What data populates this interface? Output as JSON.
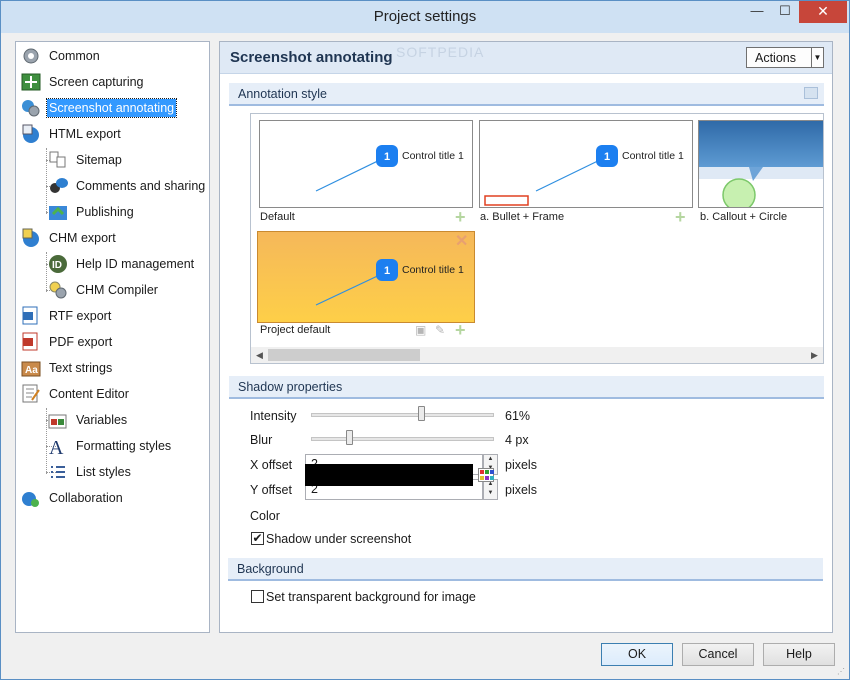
{
  "window": {
    "title": "Project settings",
    "minimize": "—",
    "maximize": "☐",
    "close": "✕"
  },
  "tree": {
    "items": [
      {
        "label": "Common",
        "icon": "gear-icon"
      },
      {
        "label": "Screen capturing",
        "icon": "capture-icon"
      },
      {
        "label": "Screenshot annotating",
        "icon": "annotate-icon",
        "selected": true
      },
      {
        "label": "HTML export",
        "icon": "html-export-icon"
      },
      {
        "label": "Sitemap",
        "icon": "sitemap-icon"
      },
      {
        "label": "Comments and sharing",
        "icon": "comments-icon"
      },
      {
        "label": "Publishing",
        "icon": "publishing-icon"
      },
      {
        "label": "CHM export",
        "icon": "chm-export-icon"
      },
      {
        "label": "Help ID management",
        "icon": "help-id-icon"
      },
      {
        "label": "CHM Compiler",
        "icon": "chm-compiler-icon"
      },
      {
        "label": "RTF export",
        "icon": "rtf-export-icon"
      },
      {
        "label": "PDF export",
        "icon": "pdf-export-icon"
      },
      {
        "label": "Text strings",
        "icon": "text-strings-icon"
      },
      {
        "label": "Content Editor",
        "icon": "content-editor-icon"
      },
      {
        "label": "Variables",
        "icon": "variables-icon"
      },
      {
        "label": "Formatting styles",
        "icon": "formatting-icon"
      },
      {
        "label": "List styles",
        "icon": "list-styles-icon"
      },
      {
        "label": "Collaboration",
        "icon": "collaboration-icon"
      }
    ]
  },
  "panel": {
    "title": "Screenshot annotating",
    "watermark": "SOFTPEDIA",
    "actions_label": "Actions"
  },
  "annotation_style": {
    "section_label": "Annotation style",
    "callout_number": "1",
    "callout_text": "Control title 1",
    "styles": [
      {
        "label": "Default"
      },
      {
        "label": "a. Bullet + Frame"
      },
      {
        "label": "b. Callout + Circle"
      },
      {
        "label": "Project default"
      }
    ]
  },
  "shadow": {
    "section_label": "Shadow properties",
    "intensity_label": "Intensity",
    "intensity_value": "61%",
    "intensity_fraction": 0.61,
    "blur_label": "Blur",
    "blur_value": "4 px",
    "blur_fraction": 0.2,
    "xoffset_label": "X offset",
    "xoffset_value": "2",
    "yoffset_label": "Y offset",
    "yoffset_value": "2",
    "unit": "pixels",
    "color_label": "Color",
    "color_hex": "#000000",
    "under_label": "Shadow under screenshot",
    "under_checked": true
  },
  "background": {
    "section_label": "Background",
    "transparent_label": "Set transparent background for image",
    "transparent_checked": false
  },
  "buttons": {
    "ok": "OK",
    "cancel": "Cancel",
    "help": "Help"
  }
}
